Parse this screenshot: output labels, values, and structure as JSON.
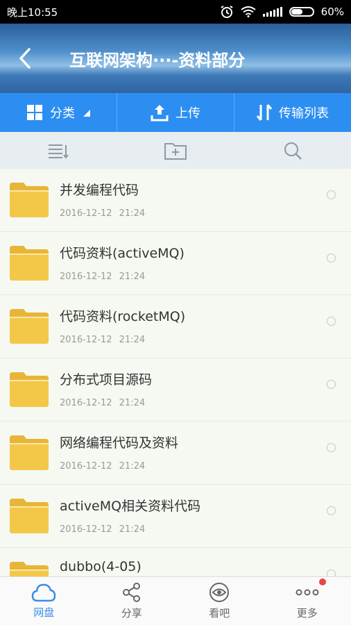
{
  "status": {
    "time": "晚上10:55",
    "battery": "60%"
  },
  "header": {
    "title": "互联网架构···-资料部分"
  },
  "actions": {
    "category": "分类",
    "upload": "上传",
    "transfer": "传输列表"
  },
  "files": [
    {
      "name": "并发编程代码",
      "date": "2016-12-12 21:24"
    },
    {
      "name": "代码资料(activeMQ)",
      "date": "2016-12-12 21:24"
    },
    {
      "name": "代码资料(rocketMQ)",
      "date": "2016-12-12 21:24"
    },
    {
      "name": "分布式项目源码",
      "date": "2016-12-12 21:24"
    },
    {
      "name": "网络编程代码及资料",
      "date": "2016-12-12 21:24"
    },
    {
      "name": "activeMQ相关资料代码",
      "date": "2016-12-12 21:24"
    },
    {
      "name": "dubbo(4-05)",
      "date": ""
    }
  ],
  "nav": {
    "disk": "网盘",
    "share": "分享",
    "watch": "看吧",
    "more": "更多"
  },
  "colors": {
    "accent": "#2d8ef2",
    "folder": "#f1c447",
    "badge": "#e84545"
  }
}
